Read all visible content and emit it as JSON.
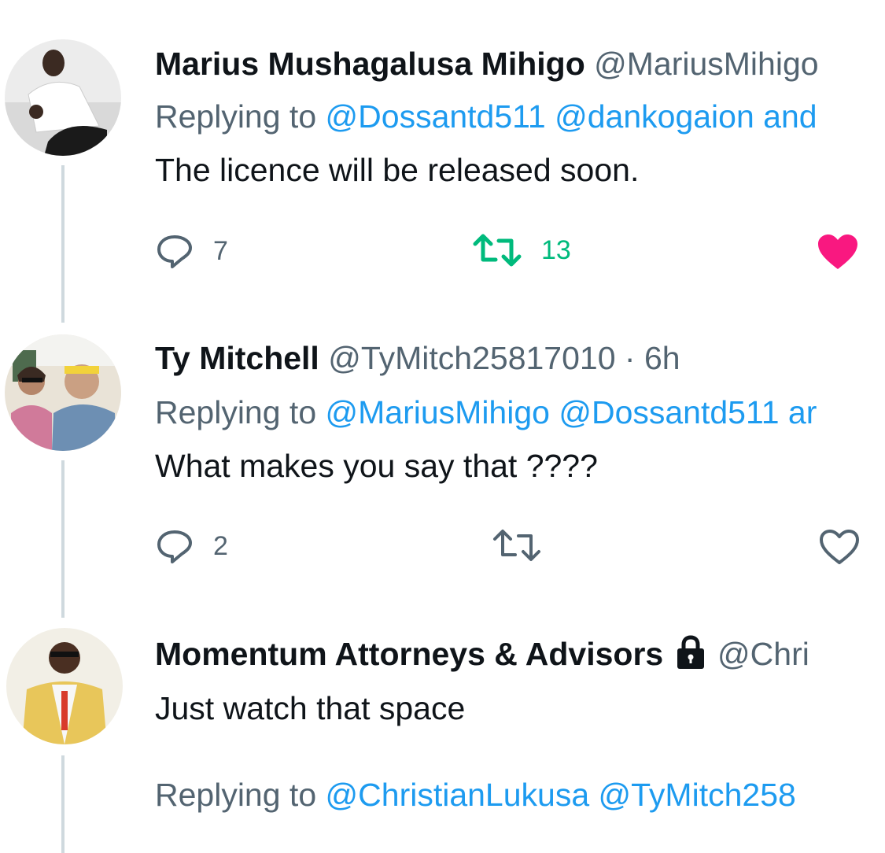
{
  "tweets": [
    {
      "name": "Marius Mushagalusa Mihigo",
      "handle": "@MariusMihigo",
      "replying_prefix": "Replying to",
      "mentions": "@Dossantd511 @dankogaion and",
      "text": "The licence will be released soon.",
      "reply_count": "7",
      "retweet_count": "13",
      "liked": true,
      "retweeted": true
    },
    {
      "name": "Ty Mitchell",
      "handle": "@TyMitch25817010",
      "time": "· 6h",
      "replying_prefix": "Replying to",
      "mentions": "@MariusMihigo @Dossantd511 ar",
      "text": "What makes you say that ????",
      "reply_count": "2",
      "liked": false,
      "retweeted": false
    },
    {
      "name": "Momentum Attorneys & Advisors",
      "handle": "@Chri",
      "badge_icon": "lock-icon",
      "text": "Just watch that space",
      "replying_prefix": "Replying to",
      "mentions": "@ChristianLukusa @TyMitch258"
    }
  ],
  "colors": {
    "link": "#1d9bf0",
    "secondary_text": "#536471",
    "like": "#f91880",
    "retweet": "#00ba7c",
    "thread_line": "#cfd9de"
  }
}
